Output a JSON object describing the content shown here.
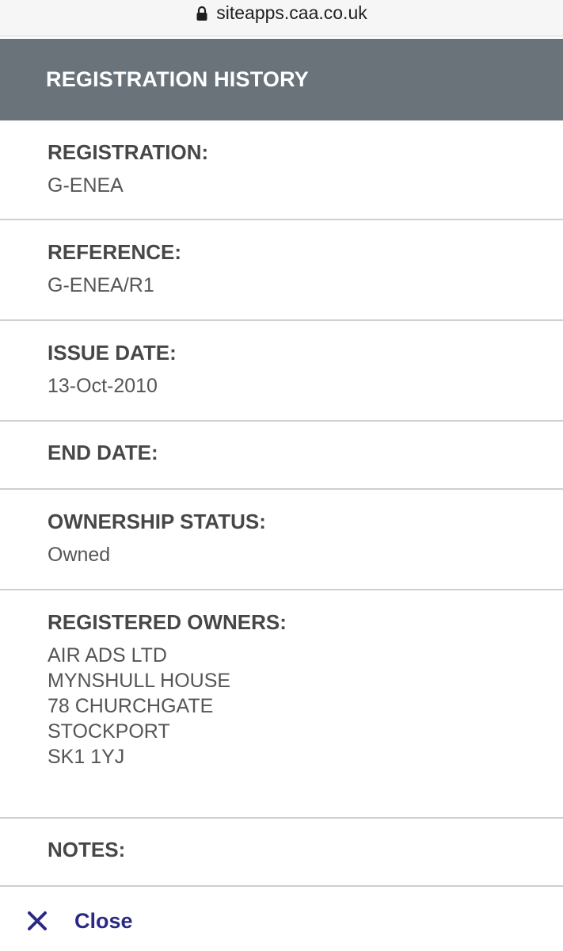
{
  "browser": {
    "url": "siteapps.caa.co.uk",
    "icon": "lock-icon"
  },
  "header": {
    "title": "REGISTRATION HISTORY"
  },
  "fields": {
    "registration": {
      "label": "REGISTRATION:",
      "value": "G-ENEA"
    },
    "reference": {
      "label": "REFERENCE:",
      "value": "G-ENEA/R1"
    },
    "issue_date": {
      "label": "ISSUE DATE:",
      "value": "13-Oct-2010"
    },
    "end_date": {
      "label": "END DATE:",
      "value": ""
    },
    "ownership_status": {
      "label": "OWNERSHIP STATUS:",
      "value": "Owned"
    },
    "registered_owners": {
      "label": "REGISTERED OWNERS:",
      "lines": [
        "AIR ADS LTD",
        "MYNSHULL HOUSE",
        "78 CHURCHGATE",
        "STOCKPORT",
        "SK1 1YJ"
      ]
    },
    "notes": {
      "label": "NOTES:",
      "value": ""
    }
  },
  "footer": {
    "close_label": "Close",
    "close_icon": "close-icon",
    "accent_color": "#2a2a86"
  },
  "colors": {
    "header_bg": "#6b737a",
    "divider": "#cfcfcf"
  }
}
